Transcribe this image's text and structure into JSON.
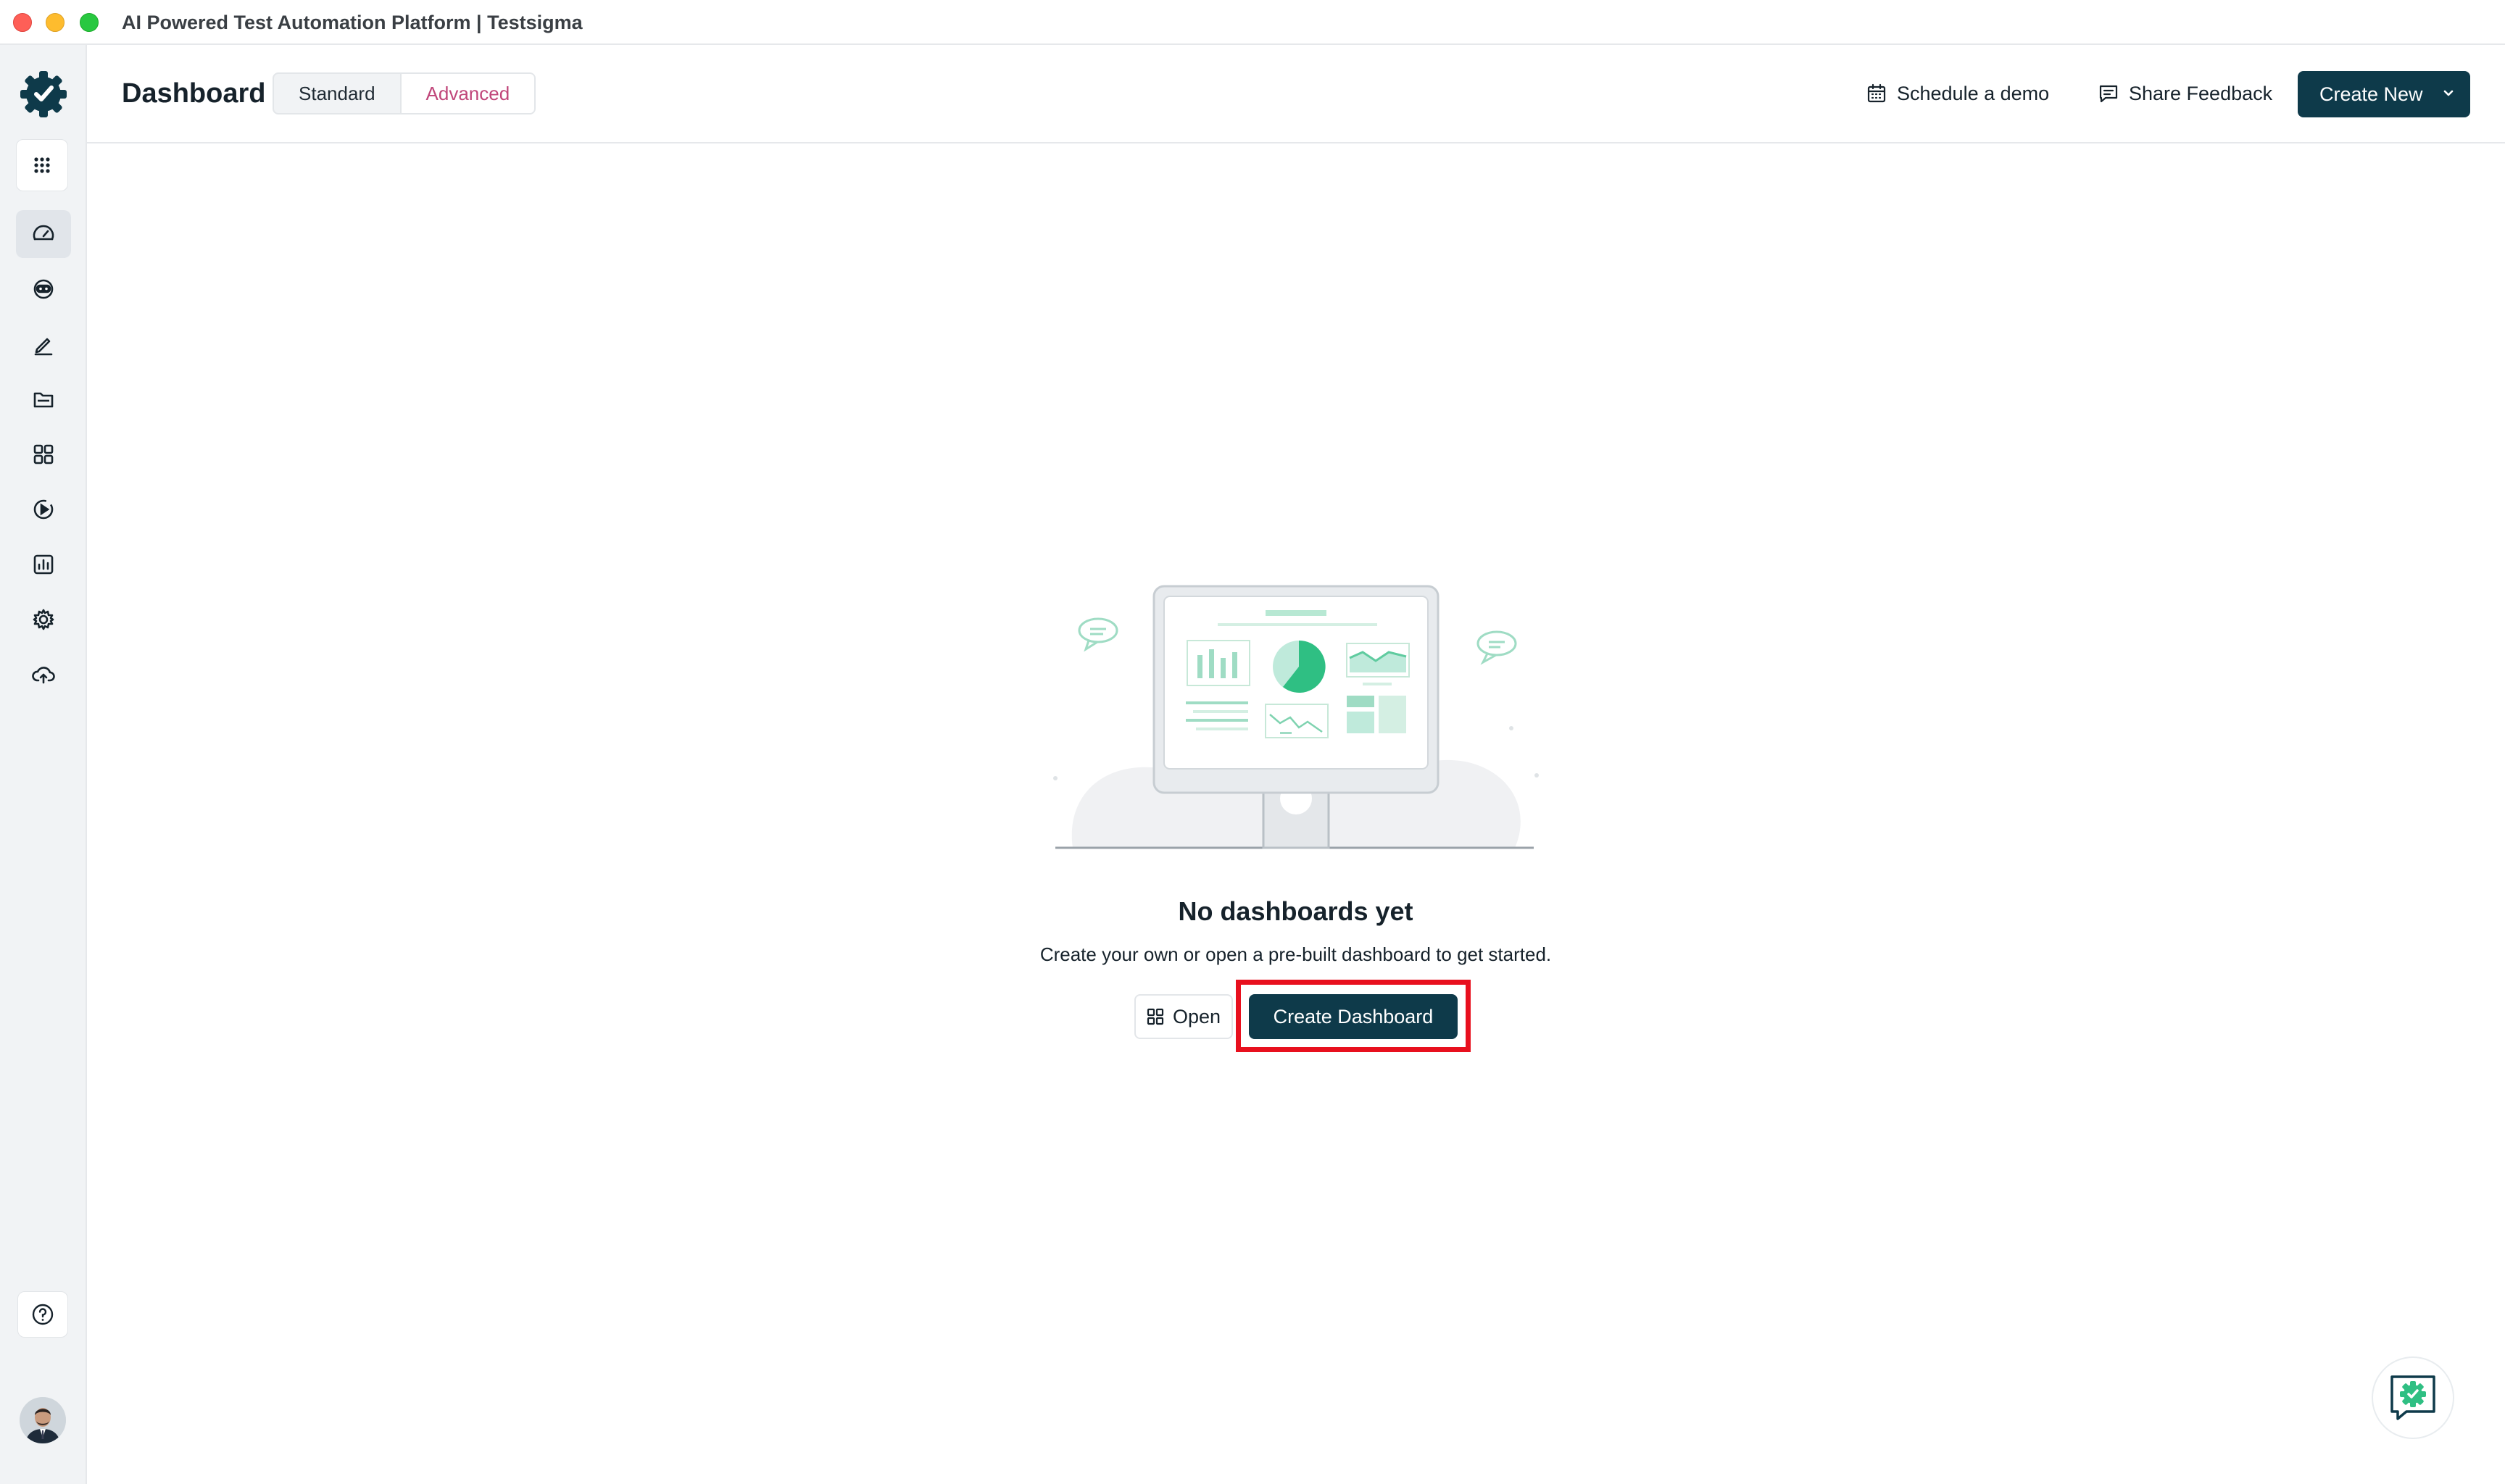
{
  "window": {
    "title": "AI Powered Test Automation Platform | Testsigma"
  },
  "sidebar": {
    "logo_icon": "testsigma-logo-icon",
    "apps_icon": "grid-dots-icon",
    "items": [
      {
        "name": "dashboard",
        "icon": "speedometer-icon",
        "active": true
      },
      {
        "name": "ai-agent",
        "icon": "robot-icon",
        "active": false
      },
      {
        "name": "test-cases",
        "icon": "pencil-icon",
        "active": false
      },
      {
        "name": "test-data",
        "icon": "folder-icon",
        "active": false
      },
      {
        "name": "elements",
        "icon": "four-squares-icon",
        "active": false
      },
      {
        "name": "runs",
        "icon": "play-circle-icon",
        "active": false
      },
      {
        "name": "reports",
        "icon": "bar-chart-icon",
        "active": false
      },
      {
        "name": "settings",
        "icon": "gear-icon",
        "active": false
      },
      {
        "name": "uploads",
        "icon": "cloud-upload-icon",
        "active": false
      }
    ],
    "help_icon": "question-circle-icon",
    "avatar_icon": "user-avatar"
  },
  "header": {
    "title": "Dashboard",
    "tabs": [
      {
        "label": "Standard",
        "selected": false
      },
      {
        "label": "Advanced",
        "selected": true
      }
    ],
    "schedule_demo": "Schedule a demo",
    "share_feedback": "Share Feedback",
    "create_new": "Create New"
  },
  "empty_state": {
    "title": "No dashboards yet",
    "subtitle": "Create your own or open a pre-built dashboard to get started.",
    "open_button": "Open",
    "create_button": "Create Dashboard"
  },
  "colors": {
    "primary": "#0e3a4a",
    "accent_selected_tab": "#c0467a",
    "highlight": "#e8101e",
    "illustration_green": "#3cbf8c"
  }
}
